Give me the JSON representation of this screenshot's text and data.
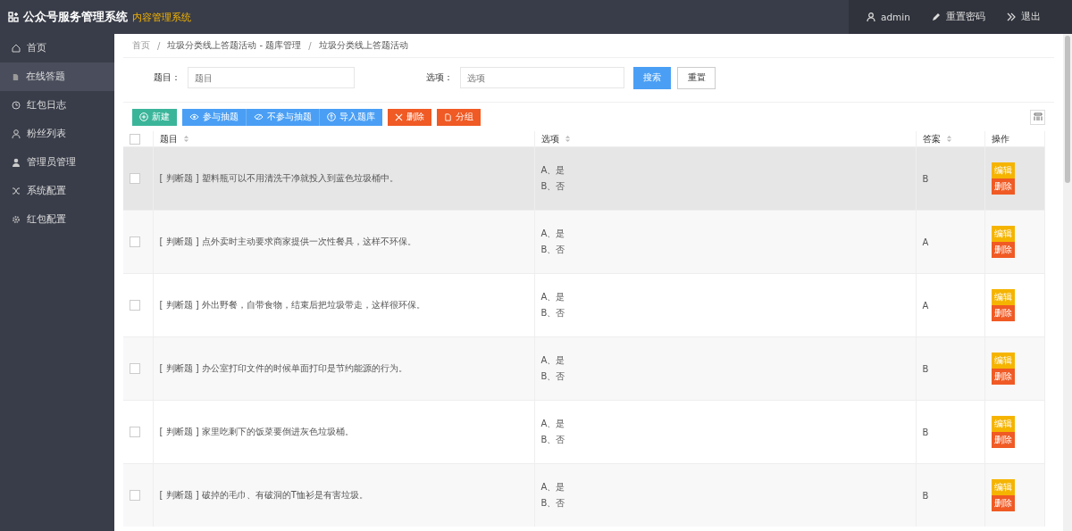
{
  "header": {
    "title": "公众号服务管理系统",
    "subtitle": "内容管理系统",
    "user": "admin",
    "reset_password": "重置密码",
    "logout": "退出"
  },
  "sidebar": {
    "items": [
      {
        "label": "首页",
        "kind": "home",
        "selected": false
      },
      {
        "label": "在线答题",
        "kind": "doc",
        "selected": true
      },
      {
        "label": "红包日志",
        "kind": "clock",
        "selected": false
      },
      {
        "label": "粉丝列表",
        "kind": "user",
        "selected": false
      },
      {
        "label": "管理员管理",
        "kind": "person",
        "selected": false
      },
      {
        "label": "系统配置",
        "kind": "shuffle",
        "selected": false
      },
      {
        "label": "红包配置",
        "kind": "gear",
        "selected": false
      }
    ]
  },
  "breadcrumb": [
    "首页",
    "垃圾分类线上答题活动 - 题库管理",
    "垃圾分类线上答题活动"
  ],
  "breadcrumb_separator": "/",
  "search": {
    "fields": [
      {
        "label": "题目：",
        "placeholder": "题目"
      },
      {
        "label": "选项：",
        "placeholder": "选项"
      }
    ],
    "search_button": "搜索",
    "reset_button": "重置"
  },
  "toolbar": [
    {
      "label": "新建",
      "kind": "create"
    },
    {
      "label": "参与抽题",
      "kind": "join"
    },
    {
      "label": "不参与抽题",
      "kind": "leave"
    },
    {
      "label": "导入题库",
      "kind": "import"
    },
    {
      "label": "删除",
      "kind": "delete"
    },
    {
      "label": "分组",
      "kind": "group"
    }
  ],
  "table": {
    "all_checked": false,
    "columns": [
      {
        "label": "题目",
        "sortable": true
      },
      {
        "label": "选项",
        "sortable": true
      },
      {
        "label": "答案",
        "sortable": true
      },
      {
        "label": "操作",
        "sortable": false
      }
    ],
    "rows": [
      {
        "checked": false,
        "hovered": true,
        "question": "[ 判断题 ] 塑料瓶可以不用清洗干净就投入到蓝色垃圾桶中。",
        "options": [
          "A、是",
          "B、否"
        ],
        "answer": "B",
        "edit_label": "编辑",
        "delete_label": "删除"
      },
      {
        "checked": false,
        "hovered": false,
        "question": "[ 判断题 ] 点外卖时主动要求商家提供一次性餐具，这样不环保。",
        "options": [
          "A、是",
          "B、否"
        ],
        "answer": "A",
        "edit_label": "编辑",
        "delete_label": "删除"
      },
      {
        "checked": false,
        "hovered": false,
        "question": "[ 判断题 ] 外出野餐，自带食物，结束后把垃圾带走，这样很环保。",
        "options": [
          "A、是",
          "B、否"
        ],
        "answer": "A",
        "edit_label": "编辑",
        "delete_label": "删除"
      },
      {
        "checked": false,
        "hovered": false,
        "question": "[ 判断题 ] 办公室打印文件的时候单面打印是节约能源的行为。",
        "options": [
          "A、是",
          "B、否"
        ],
        "answer": "B",
        "edit_label": "编辑",
        "delete_label": "删除"
      },
      {
        "checked": false,
        "hovered": false,
        "question": "[ 判断题 ] 家里吃剩下的饭菜要倒进灰色垃圾桶。",
        "options": [
          "A、是",
          "B、否"
        ],
        "answer": "B",
        "edit_label": "编辑",
        "delete_label": "删除"
      },
      {
        "checked": false,
        "hovered": false,
        "question": "[ 判断题 ] 破掉的毛巾、有破洞的T恤衫是有害垃圾。",
        "options": [
          "A、是",
          "B、否"
        ],
        "answer": "B",
        "edit_label": "编辑",
        "delete_label": "删除"
      }
    ]
  }
}
